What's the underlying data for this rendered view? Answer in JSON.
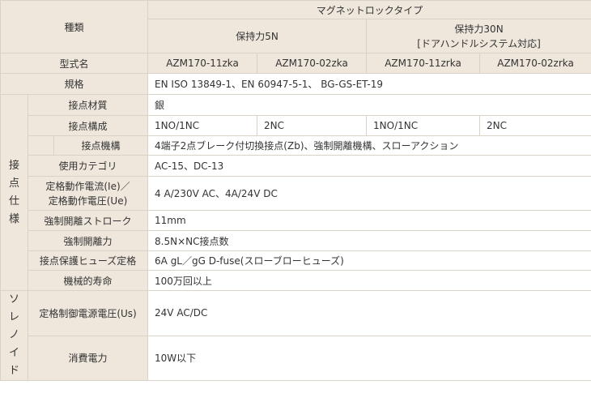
{
  "header": {
    "type_label": "種類",
    "group_label": "マグネットロックタイプ",
    "hold5_label": "保持力5N",
    "hold30_line1": "保持力30N",
    "hold30_line2": "[ドアハンドルシステム対応]"
  },
  "model": {
    "label": "型式名",
    "values": [
      "AZM170-11zka",
      "AZM170-02zka",
      "AZM170-11zrka",
      "AZM170-02zrka"
    ]
  },
  "standard": {
    "label": "規格",
    "value": "EN ISO 13849-1、EN 60947-5-1、 BG-GS-ET-19"
  },
  "contact_section": {
    "side_chars": [
      "接",
      "点",
      "仕",
      "様"
    ],
    "material": {
      "label": "接点材質",
      "value": "銀"
    },
    "config": {
      "label": "接点構成",
      "values": [
        "1NO/1NC",
        "2NC",
        "1NO/1NC",
        "2NC"
      ]
    },
    "mechanism": {
      "label": "接点機構",
      "value": "4端子2点ブレーク付切換接点(Zb)、強制開離機構、スローアクション"
    },
    "category": {
      "label": "使用カテゴリ",
      "value": "AC-15、DC-13"
    },
    "rated": {
      "label_line1": "定格動作電流(Ie)／",
      "label_line2": "定格動作電圧(Ue)",
      "value": "4 A/230V AC、4A/24V DC"
    },
    "stroke": {
      "label": "強制開離ストローク",
      "value": "11mm"
    },
    "force": {
      "label": "強制開離力",
      "value": "8.5N×NC接点数"
    },
    "fuse": {
      "label": "接点保護ヒューズ定格",
      "value": "6A gL／gG D-fuse(スローブローヒューズ)"
    },
    "life": {
      "label": "機械的寿命",
      "value": "100万回以上"
    }
  },
  "solenoid_section": {
    "side_chars": [
      "ソ",
      "レ",
      "ノ",
      "イ",
      "ド"
    ],
    "voltage": {
      "label": "定格制御電源電圧(Us)",
      "value": "24V AC/DC"
    },
    "power": {
      "label": "消費電力",
      "value": "10W以下"
    }
  }
}
